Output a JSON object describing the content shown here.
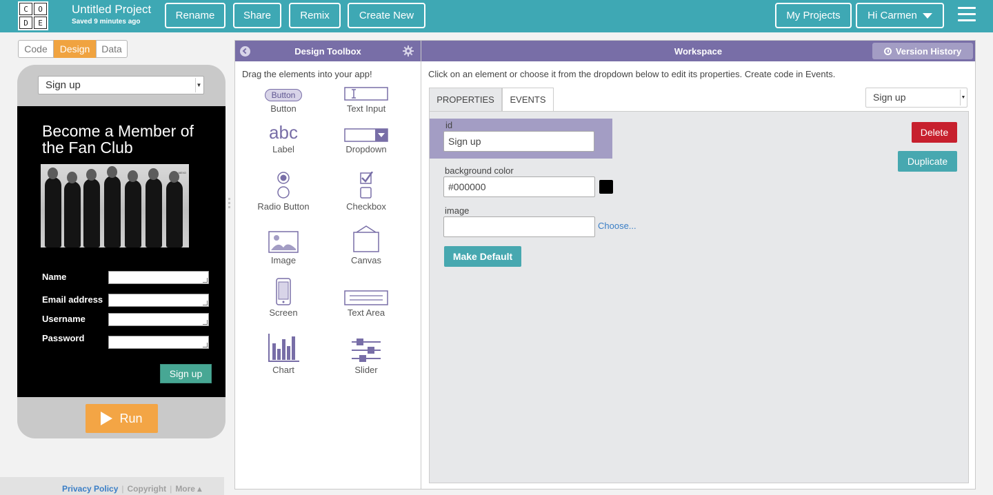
{
  "header": {
    "logo_letters": [
      "C",
      "O",
      "D",
      "E"
    ],
    "project_title": "Untitled Project",
    "saved_status": "Saved 9 minutes ago",
    "rename": "Rename",
    "share": "Share",
    "remix": "Remix",
    "create_new": "Create New",
    "my_projects": "My Projects",
    "greeting": "Hi Carmen",
    "accent_color": "#3ea8b4"
  },
  "modes": [
    "Code",
    "Design",
    "Data"
  ],
  "active_mode": "Design",
  "app_preview": {
    "screen_select": "Sign up",
    "heading": "Become a Member of the Fan Club",
    "photo_tag": "NEXO",
    "fields": [
      "Name",
      "Email address",
      "Username",
      "Password"
    ],
    "signup_button": "Sign up",
    "run_button": "Run"
  },
  "footer": {
    "privacy": "Privacy Policy",
    "sep": "|",
    "copyright": "Copyright",
    "more": "More ▴"
  },
  "toolbox": {
    "title": "Design Toolbox",
    "hint": "Drag the elements into your app!",
    "button_icon_text": "Button",
    "label_icon_text": "abc",
    "tools": [
      "Button",
      "Text Input",
      "Label",
      "Dropdown",
      "Radio Button",
      "Checkbox",
      "Image",
      "Canvas",
      "Screen",
      "Text Area",
      "Chart",
      "Slider"
    ],
    "accent_color": "#786ea7"
  },
  "workspace": {
    "title": "Workspace",
    "version_history": "Version History",
    "hint": "Click on an element or choose it from the dropdown below to edit its properties. Create code in Events.",
    "tabs": [
      "PROPERTIES",
      "EVENTS"
    ],
    "element_select": "Sign up",
    "properties": {
      "id_label": "id",
      "id_value": "Sign up",
      "bg_label": "background color",
      "bg_value": "#000000",
      "image_label": "image",
      "image_value": "",
      "choose": "Choose...",
      "make_default": "Make Default",
      "delete": "Delete",
      "duplicate": "Duplicate"
    }
  }
}
